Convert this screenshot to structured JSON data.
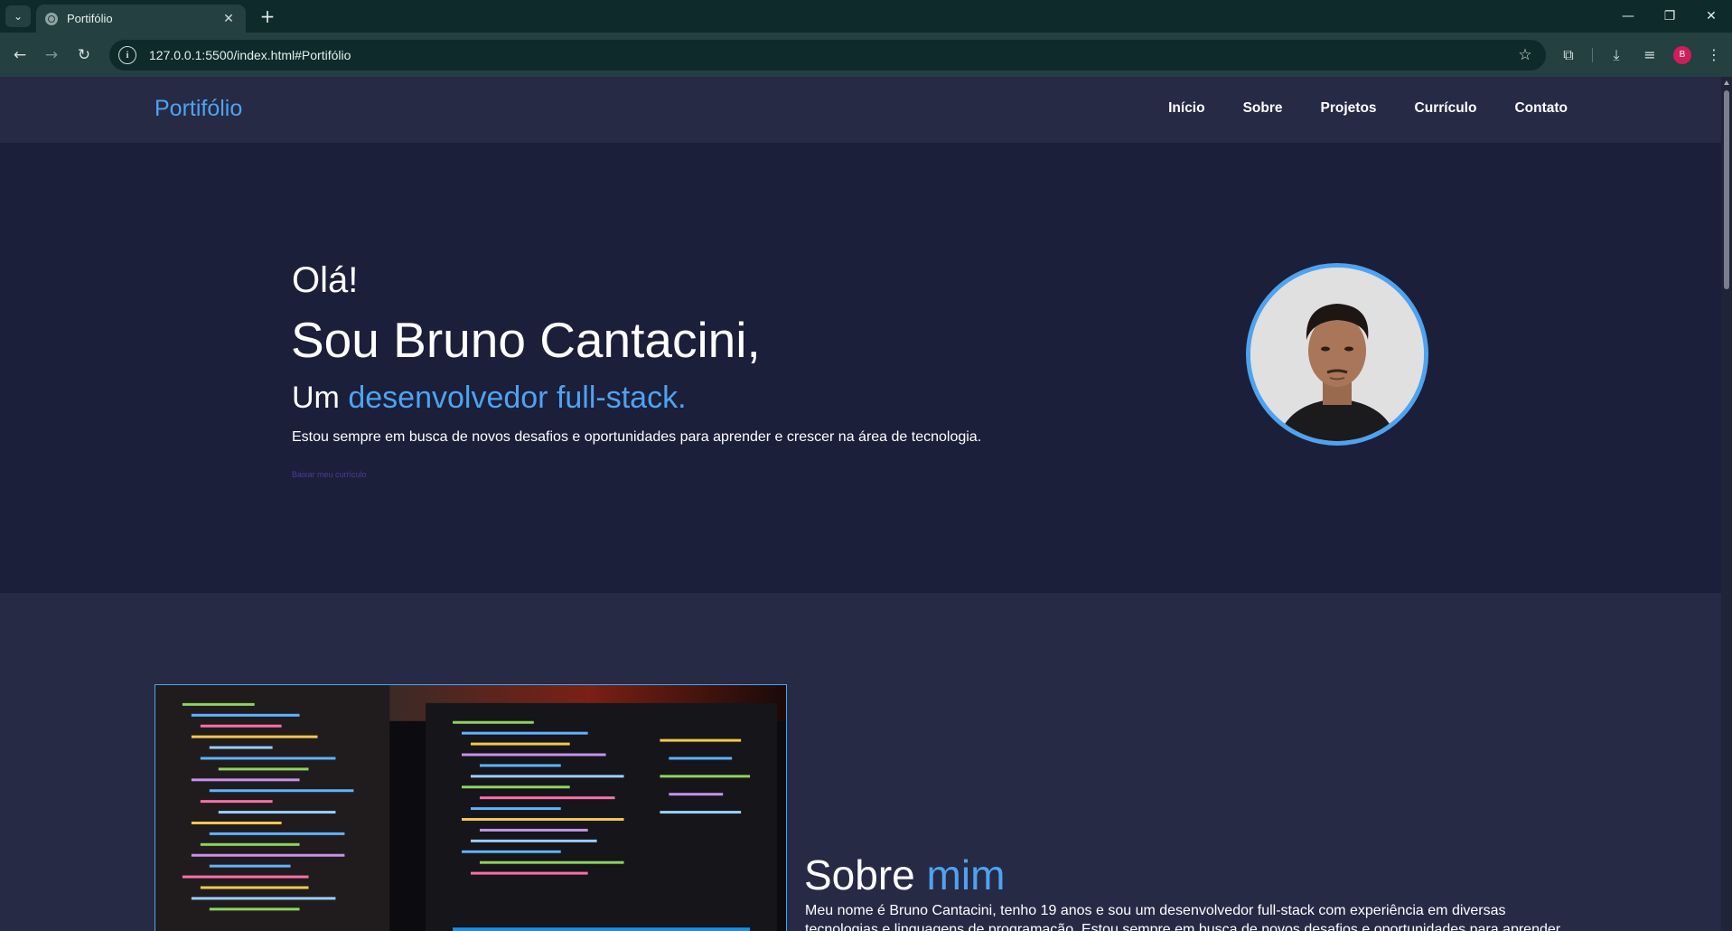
{
  "browser": {
    "tab_title": "Portifólio",
    "url": "127.0.0.1:5500/index.html#Portifólio",
    "profile_initial": "B"
  },
  "site": {
    "logo": "Portifólio",
    "nav": [
      "Início",
      "Sobre",
      "Projetos",
      "Currículo",
      "Contato"
    ]
  },
  "hero": {
    "greeting": "Olá!",
    "name": "Sou Bruno Cantacini,",
    "role_prefix": "Um",
    "role_accent": "desenvolvedor full-stack.",
    "description": "Estou sempre em busca de novos desafios e oportunidades para aprender e crescer na área de tecnologia.",
    "cv_link": "Baixar meu currículo"
  },
  "about": {
    "title_prefix": "Sobre",
    "title_accent": "mim",
    "text": "Meu nome é Bruno Cantacini, tenho 19 anos e sou um desenvolvedor full-stack com experiência em diversas tecnologias e linguagens de programação. Estou sempre em busca de novos desafios e oportunidades para aprender"
  },
  "colors": {
    "accent": "#4ea3f0",
    "hero_bg": "#1b1f3a",
    "header_bg": "#262a45",
    "chrome_bg": "#244040"
  }
}
